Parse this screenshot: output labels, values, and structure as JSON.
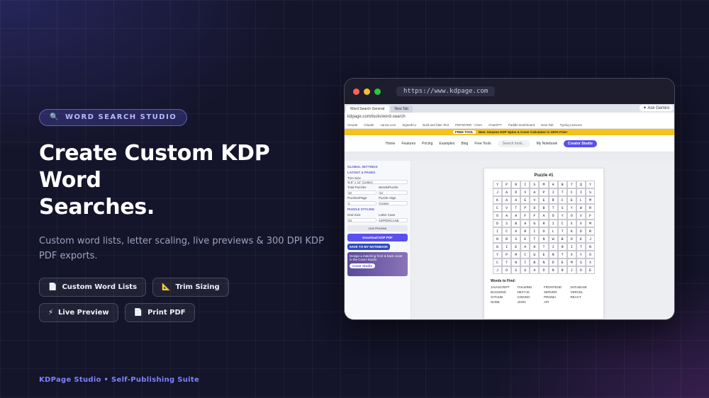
{
  "hero": {
    "badge": "WORD SEARCH STUDIO",
    "badge_icon": "magnifier-icon",
    "title_line1": "Create Custom KDP Word",
    "title_line2": "Searches.",
    "subtitle": "Custom word lists, letter scaling, live previews & 300 DPI KDP PDF exports.",
    "chips": [
      {
        "icon": "📄",
        "label": "Custom Word Lists"
      },
      {
        "icon": "📐",
        "label": "Trim Sizing"
      },
      {
        "icon": "⚡",
        "label": "Live Preview"
      },
      {
        "icon": "📄",
        "label": "Print PDF"
      }
    ]
  },
  "footer": "KDPage Studio • Self-Publishing Suite",
  "colors": {
    "accent": "#7e82ff",
    "badge_text": "#b9b9ff",
    "red": "#ff5f57",
    "yellow": "#febc2e",
    "green": "#28c840"
  },
  "browser": {
    "url": "https://www.kdpage.com",
    "tabs": [
      "Word Search Generat",
      "New Tab"
    ],
    "gemini": "Ask Gemini",
    "address": "kdpage.com/tools/word-search",
    "bookmarks": [
      "Claude",
      "Claude",
      "canva.com",
      "SignedCo",
      "Bold and fake Text",
      "PDFWORD - Chen",
      "ChatGPT",
      "Paddle Dashboard",
      "New Tab",
      "Typing Lessons"
    ],
    "promo_tag": "FREE TOOL",
    "promo_text": "New: Amazon KDP Spine & Cover Calculator is 100% Free!",
    "nav": [
      "Home",
      "Features",
      "Pricing",
      "Examples",
      "Blog",
      "Free Tools"
    ],
    "search": "Search tools...",
    "notebook": "My Notebook",
    "creator": "Creator Studio"
  },
  "sidebar": {
    "header": "GLOBAL SETTINGS",
    "layout": "LAYOUT & PAGES",
    "trim_label": "Trim Size",
    "trim_value": "8.5\" x 11\" (Letter)",
    "total_label": "Total Puzzles",
    "total_value": "10",
    "words_label": "Words/Puzzle",
    "words_value": "12",
    "ppp_label": "Puzzles/Page",
    "ppp_value": "1",
    "align_label": "Puzzle Align",
    "align_value": "Center",
    "styling": "PUZZLE STYLING",
    "grid_label": "Grid Size",
    "grid_value": "10",
    "case_label": "Letter Case",
    "case_value": "UPPERCASE",
    "preview_btn": "Live Preview",
    "download_btn": "Download KDP PDF",
    "save_btn": "SAVE TO MY NOTEBOOK",
    "cover_text": "Design a matching front & back cover in the Cover Studio",
    "cover_btn": "Cover Studio"
  },
  "puzzle": {
    "title": "Puzzle #1",
    "grid": [
      [
        "Y",
        "P",
        "R",
        "I",
        "S",
        "M",
        "A",
        "B",
        "T",
        "Q",
        "Y"
      ],
      [
        "J",
        "A",
        "D",
        "V",
        "A",
        "P",
        "I",
        "T",
        "C",
        "I",
        "S"
      ],
      [
        "K",
        "A",
        "A",
        "E",
        "V",
        "E",
        "R",
        "C",
        "E",
        "L",
        "M"
      ],
      [
        "C",
        "V",
        "T",
        "P",
        "D",
        "B",
        "T",
        "S",
        "Y",
        "W",
        "R"
      ],
      [
        "O",
        "A",
        "A",
        "F",
        "F",
        "A",
        "O",
        "Y",
        "O",
        "V",
        "F"
      ],
      [
        "D",
        "S",
        "B",
        "A",
        "G",
        "R",
        "I",
        "C",
        "X",
        "V",
        "M"
      ],
      [
        "I",
        "C",
        "A",
        "R",
        "I",
        "O",
        "L",
        "T",
        "K",
        "D",
        "R"
      ],
      [
        "N",
        "R",
        "S",
        "E",
        "T",
        "N",
        "W",
        "B",
        "O",
        "E",
        "J"
      ],
      [
        "G",
        "I",
        "E",
        "A",
        "H",
        "T",
        "I",
        "N",
        "I",
        "T",
        "N"
      ],
      [
        "Y",
        "P",
        "M",
        "C",
        "U",
        "E",
        "N",
        "T",
        "X",
        "Y",
        "O"
      ],
      [
        "C",
        "T",
        "N",
        "T",
        "B",
        "N",
        "D",
        "E",
        "M",
        "S",
        "X"
      ],
      [
        "J",
        "O",
        "S",
        "U",
        "A",
        "D",
        "N",
        "R",
        "J",
        "O",
        "E"
      ]
    ],
    "words_title": "Words to Find:",
    "words": [
      "JAVASCRIPT",
      "TAILWIND",
      "FRONTEND",
      "DATABASE",
      "BACKEND",
      "NEXTJS",
      "SERVER",
      "VERCEL",
      "GITHUB",
      "CODING",
      "PRISMA",
      "REACT",
      "NODE",
      "JSON",
      "API"
    ]
  }
}
